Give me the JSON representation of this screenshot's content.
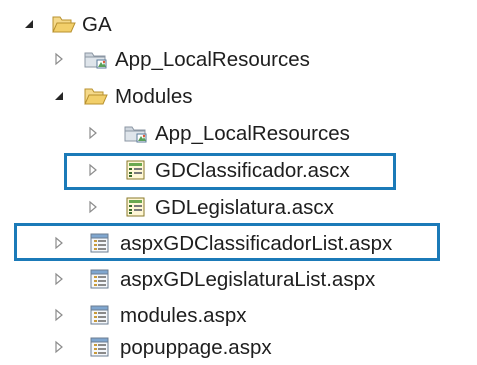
{
  "tree": {
    "items": [
      {
        "label": "GA",
        "kind": "folder-open",
        "expanded": true,
        "depth": 0
      },
      {
        "label": "App_LocalResources",
        "kind": "resource-folder",
        "expanded": false,
        "depth": 1
      },
      {
        "label": "Modules",
        "kind": "folder-open",
        "expanded": true,
        "depth": 1
      },
      {
        "label": "App_LocalResources",
        "kind": "resource-folder",
        "expanded": false,
        "depth": 2
      },
      {
        "label": "GDClassificador.ascx",
        "kind": "user-control",
        "expanded": false,
        "depth": 2,
        "highlighted": true
      },
      {
        "label": "GDLegislatura.ascx",
        "kind": "user-control",
        "expanded": false,
        "depth": 2
      },
      {
        "label": "aspxGDClassificadorList.aspx",
        "kind": "web-page",
        "expanded": false,
        "depth": 1,
        "highlighted": true
      },
      {
        "label": "aspxGDLegislaturaList.aspx",
        "kind": "web-page",
        "expanded": false,
        "depth": 1
      },
      {
        "label": "modules.aspx",
        "kind": "web-page",
        "expanded": false,
        "depth": 1
      },
      {
        "label": "popuppage.aspx",
        "kind": "web-page",
        "expanded": false,
        "depth": 1
      }
    ]
  },
  "colors": {
    "highlight_border": "#1b7ab8",
    "folder": "#e8c35e",
    "text": "#1e1e1e"
  }
}
